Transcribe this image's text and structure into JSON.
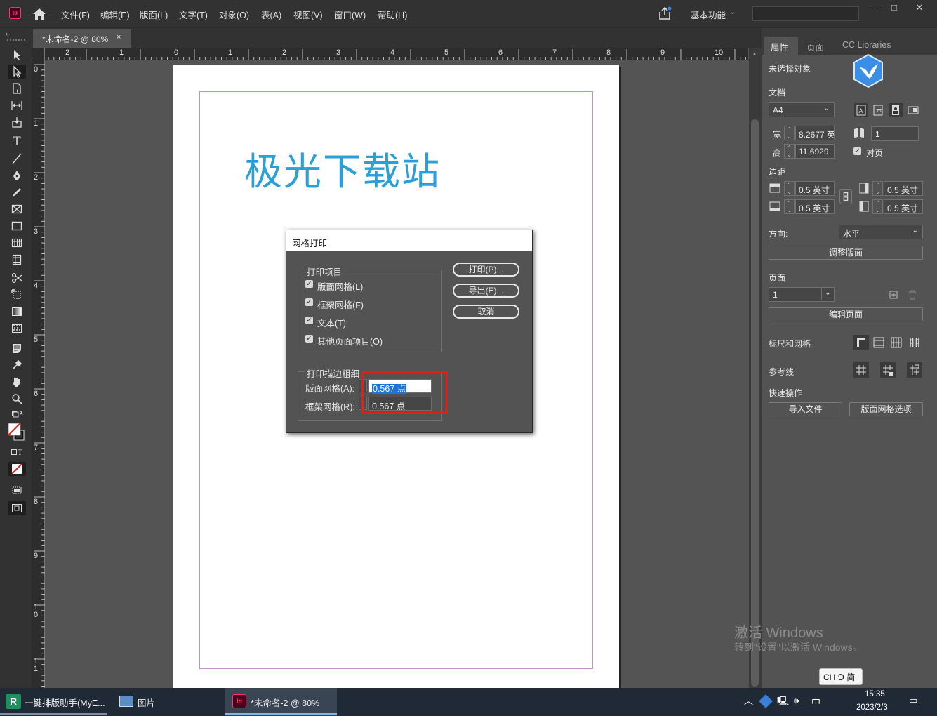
{
  "app": {
    "logo_text": "Id"
  },
  "menu": [
    "文件(F)",
    "编辑(E)",
    "版面(L)",
    "文字(T)",
    "对象(O)",
    "表(A)",
    "视图(V)",
    "窗口(W)",
    "帮助(H)"
  ],
  "workspace": "基本功能",
  "window_controls": {
    "minimize": "—",
    "maximize": "□",
    "close": "✕"
  },
  "document_tab": {
    "title": "*未命名-2 @ 80%",
    "close": "×"
  },
  "ruler": {
    "horizontal": [
      "2",
      "1",
      "0",
      "1",
      "2",
      "3",
      "4",
      "5",
      "6",
      "7",
      "8",
      "9",
      "10"
    ],
    "vertical": [
      "0",
      "1",
      "2",
      "3",
      "4",
      "5",
      "6",
      "7",
      "8",
      "9",
      "1\n0",
      "1\n1"
    ]
  },
  "page_text": "极光下载站",
  "dialog": {
    "title": "网格打印",
    "group1_legend": "打印项目",
    "checkboxes": [
      {
        "label": "版面网格(L)",
        "checked": true
      },
      {
        "label": "框架网格(F)",
        "checked": true
      },
      {
        "label": "文本(T)",
        "checked": true
      },
      {
        "label": "其他页面项目(O)",
        "checked": true
      }
    ],
    "buttons": {
      "print": "打印(P)...",
      "export": "导出(E)...",
      "cancel": "取消"
    },
    "group2_legend": "打印描边粗细",
    "fields": {
      "layout_grid_label": "版面网格(A):",
      "layout_grid_value": "0.567 点",
      "frame_grid_label": "框架网格(R):",
      "frame_grid_value": "0.567 点"
    }
  },
  "panel": {
    "tabs": [
      "属性",
      "页面",
      "CC Libraries"
    ],
    "no_selection": "未选择对象",
    "document_heading": "文档",
    "page_size": "A4",
    "width_label": "宽",
    "width_value": "8.2677 英",
    "height_label": "高",
    "height_value": "11.6929",
    "pages_count": "1",
    "facing_pages_label": "对页",
    "facing_pages_checked": true,
    "margins_heading": "边距",
    "margin_top": "0.5 英寸",
    "margin_bottom": "0.5 英寸",
    "margin_left": "0.5 英寸",
    "margin_right": "0.5 英寸",
    "orientation_label": "方向:",
    "orientation_value": "水平",
    "adjust_layout_button": "调整版面",
    "page_heading": "页面",
    "page_value": "1",
    "edit_page_button": "编辑页面",
    "rulers_grids_heading": "标尺和网格",
    "guides_heading": "参考线",
    "quick_actions_heading": "快速操作",
    "import_file_button": "导入文件",
    "layout_grid_options_button": "版面网格选项"
  },
  "watermark": {
    "line1": "激活 Windows",
    "line2": "转到\"设置\"以激活 Windows。"
  },
  "taskbar": {
    "items": [
      "一键排版助手(MyE...",
      "图片",
      "*未命名-2 @ 80%"
    ],
    "ime": "CH ⅁ 简",
    "ime_lang": "中",
    "time": "15:35",
    "date": "2023/2/3"
  },
  "colors": {
    "accent_blue": "#2c9fd7",
    "highlight_red": "#e01e1e",
    "indesign_pink": "#ff3366"
  }
}
